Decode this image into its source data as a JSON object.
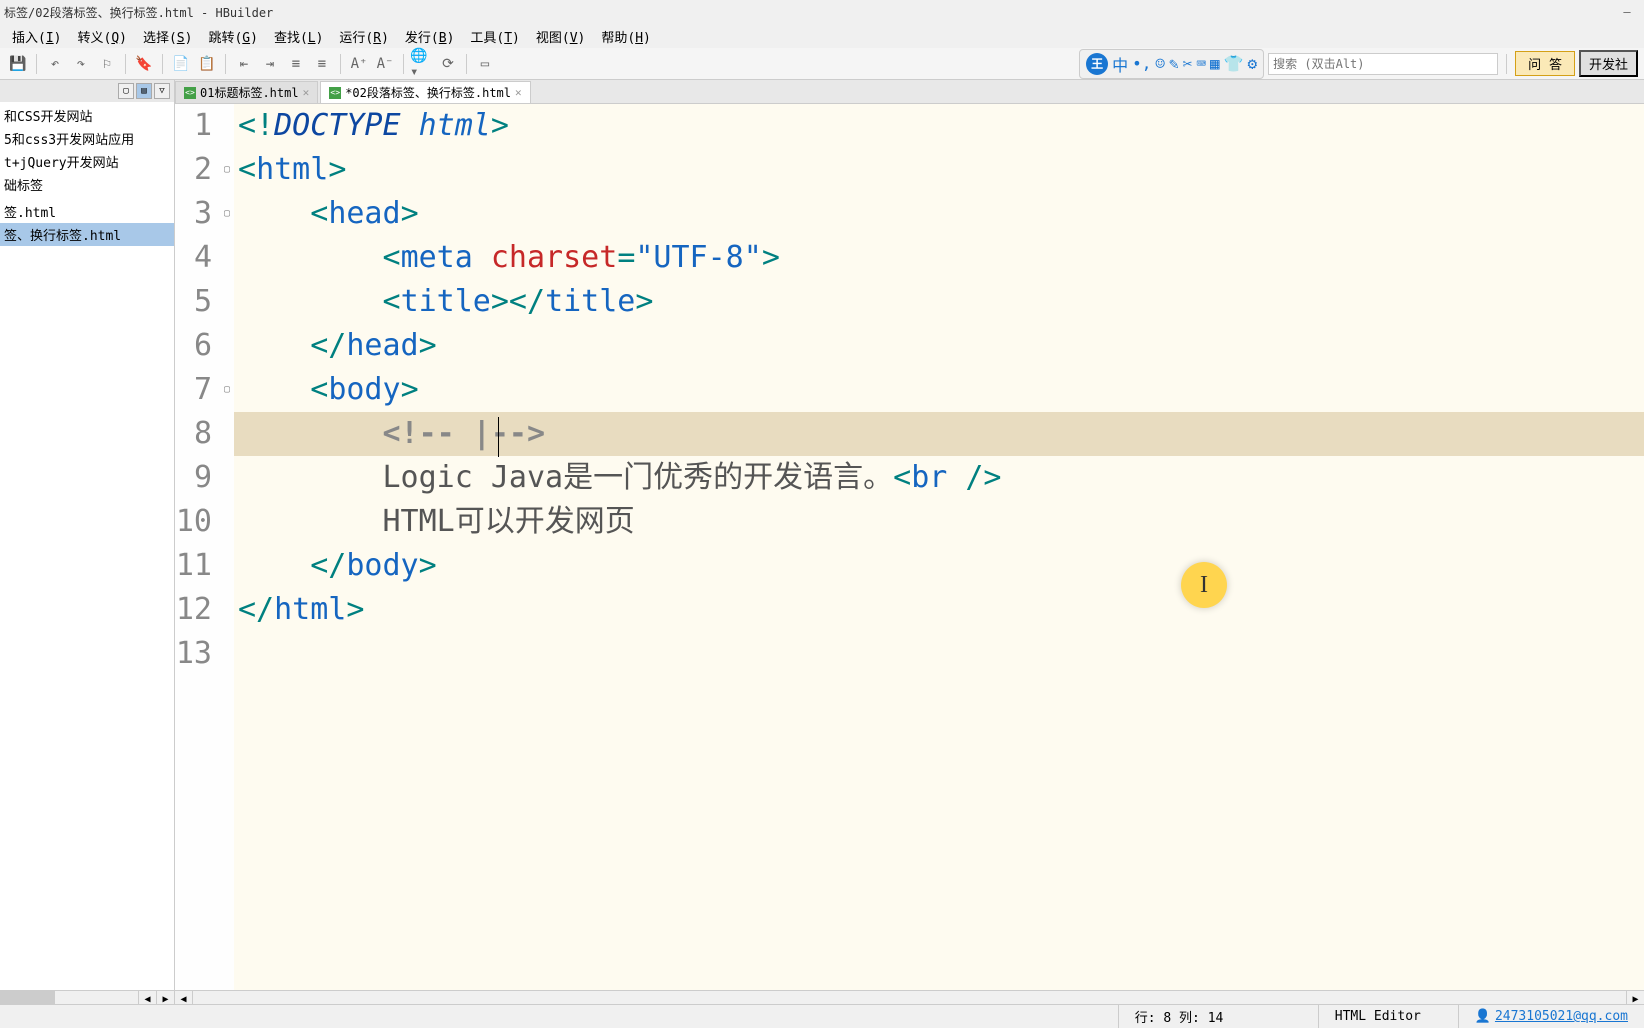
{
  "title": "标签/02段落标签、换行标签.html - HBuilder",
  "menus": [
    "插入(I)",
    "转义(Q)",
    "选择(S)",
    "跳转(G)",
    "查找(L)",
    "运行(R)",
    "发行(B)",
    "工具(T)",
    "视图(V)",
    "帮助(H)"
  ],
  "search_placeholder": "搜索 (双击Alt)",
  "ask_btn": "问 答",
  "dev_btn": "开发社",
  "ime_char": "王",
  "ime_syms": [
    "中",
    "•,",
    "☺",
    "✎",
    "✂",
    "⌨",
    "▦",
    "👕",
    "⚙"
  ],
  "sidebar": {
    "items": [
      "和CSS开发网站",
      "5和css3开发网站应用",
      "t+jQuery开发网站",
      "础标签",
      "",
      "签.html",
      "签、换行标签.html"
    ],
    "selected": 6
  },
  "tabs": [
    {
      "label": "01标题标签.html",
      "active": false
    },
    {
      "label": "*02段落标签、换行标签.html",
      "active": true
    }
  ],
  "code_lines": [
    {
      "n": "1",
      "fold": "",
      "html": "<span class='punct'>&lt;!</span><span class='doctype-word'>DOCTYPE</span><span class='doctype'> html</span><span class='punct'>&gt;</span>"
    },
    {
      "n": "2",
      "fold": "▢",
      "html": "<span class='punct'>&lt;</span><span class='tag'>html</span><span class='punct'>&gt;</span>"
    },
    {
      "n": "3",
      "fold": "▢",
      "html": "    <span class='punct'>&lt;</span><span class='tag'>head</span><span class='punct'>&gt;</span>"
    },
    {
      "n": "4",
      "fold": "",
      "html": "        <span class='punct'>&lt;</span><span class='tag'>meta</span> <span class='attr'>charset</span><span class='punct'>=</span><span class='str'>\"UTF-8\"</span><span class='punct'>&gt;</span>"
    },
    {
      "n": "5",
      "fold": "",
      "html": "        <span class='punct'>&lt;</span><span class='tag'>title</span><span class='punct'>&gt;&lt;/</span><span class='tag'>title</span><span class='punct'>&gt;</span>"
    },
    {
      "n": "6",
      "fold": "",
      "html": "    <span class='punct'>&lt;/</span><span class='tag'>head</span><span class='punct'>&gt;</span>"
    },
    {
      "n": "7",
      "fold": "▢",
      "html": "    <span class='punct'>&lt;</span><span class='tag'>body</span><span class='punct'>&gt;</span>"
    },
    {
      "n": "8",
      "fold": "",
      "current": true,
      "html": "        <span class='comment'>&lt;!-- |--&gt;</span>"
    },
    {
      "n": "9",
      "fold": "",
      "html": "        <span class='text'>Logic Java是一门优秀的开发语言。</span><span class='punct'>&lt;</span><span class='tag'>br</span> <span class='punct'>/&gt;</span>"
    },
    {
      "n": "10",
      "fold": "",
      "html": "        <span class='text'>HTML可以开发网页</span>"
    },
    {
      "n": "11",
      "fold": "",
      "html": "    <span class='punct'>&lt;/</span><span class='tag'>body</span><span class='punct'>&gt;</span>"
    },
    {
      "n": "12",
      "fold": "",
      "html": "<span class='punct'>&lt;/</span><span class='tag'>html</span><span class='punct'>&gt;</span>"
    },
    {
      "n": "13",
      "fold": "",
      "html": ""
    }
  ],
  "status": {
    "position": "行: 8 列: 14",
    "editor": "HTML Editor",
    "user": "2473105021@qq.com"
  }
}
